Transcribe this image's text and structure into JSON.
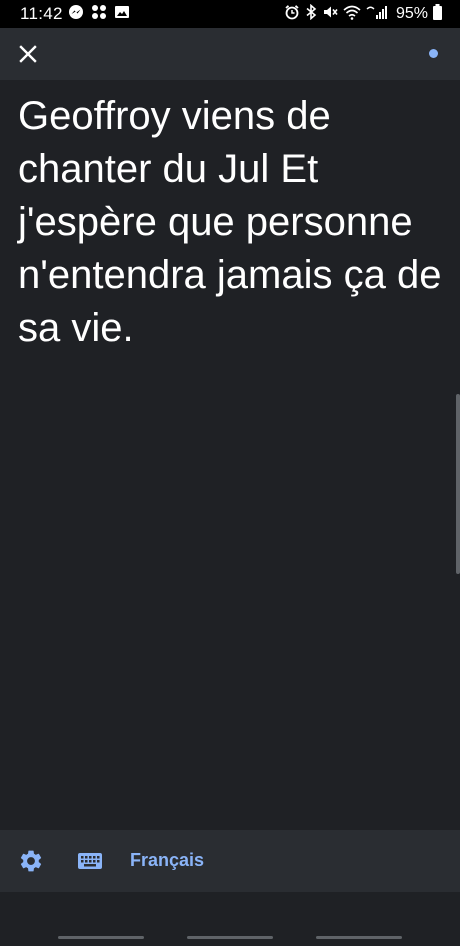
{
  "status_bar": {
    "time": "11:42",
    "battery_percent": "95%",
    "left_icons": [
      "messenger-icon",
      "app-grid-icon",
      "gallery-icon"
    ],
    "right_icons": [
      "alarm-icon",
      "bluetooth-icon",
      "mute-icon",
      "wifi-icon",
      "signal-icon",
      "battery-icon"
    ]
  },
  "app_bar": {
    "close_icon": "close-icon",
    "listening_indicator_color": "#8ab4f8"
  },
  "transcript": {
    "text": "Geoffroy viens de chanter du Jul Et j'espère que personne n'entendra jamais ça de sa vie."
  },
  "toolbar": {
    "settings_icon": "gear-icon",
    "keyboard_icon": "keyboard-icon",
    "language_label": "Français"
  },
  "colors": {
    "accent": "#8ab4f8",
    "background": "#1f2125",
    "bar": "#2a2d32"
  }
}
